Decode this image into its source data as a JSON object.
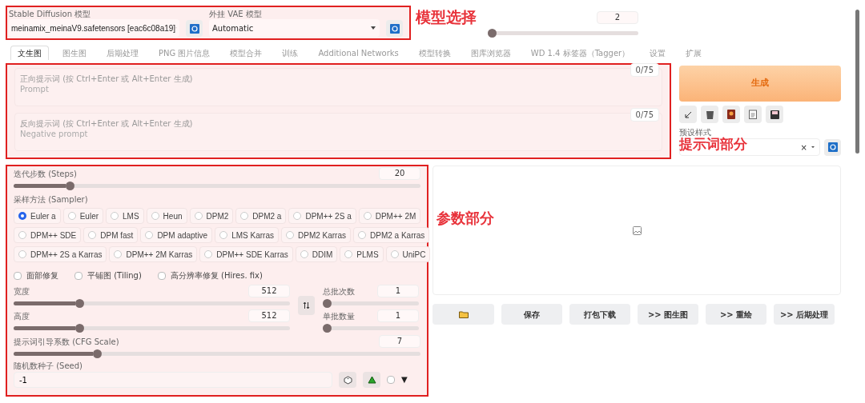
{
  "model_bar": {
    "sd_model": {
      "label": "Stable Diffusion 模型",
      "value": "meinamix_meinaV9.safetensors [eac6c08a19]"
    },
    "vae": {
      "label": "外挂 VAE 模型",
      "value": "Automatic"
    },
    "slider": {
      "value": "2",
      "level": 0
    }
  },
  "annotations": [
    {
      "text": "模型选择"
    },
    {
      "text": "提示词部分"
    },
    {
      "text": "参数部分"
    }
  ],
  "tabs": [
    {
      "label": "文生图",
      "selected": true
    },
    {
      "label": "图生图",
      "selected": false
    },
    {
      "label": "后期处理",
      "selected": false
    },
    {
      "label": "PNG 图片信息",
      "selected": false
    },
    {
      "label": "模型合并",
      "selected": false
    },
    {
      "label": "训练",
      "selected": false
    },
    {
      "label": "Additional Networks",
      "selected": false
    },
    {
      "label": "模型转换",
      "selected": false
    },
    {
      "label": "图库浏览器",
      "selected": false
    },
    {
      "label": "WD 1.4 标签器（Tagger）",
      "selected": false
    },
    {
      "label": "设置",
      "selected": false
    },
    {
      "label": "扩展",
      "selected": false
    }
  ],
  "prompts": [
    {
      "label": "正向提示词 (按 Ctrl+Enter 或 Alt+Enter 生成)",
      "placeholder": "Prompt",
      "counter": "0/75"
    },
    {
      "label": "反向提示词 (按 Ctrl+Enter 或 Alt+Enter 生成)",
      "placeholder": "Negative prompt",
      "counter": "0/75"
    }
  ],
  "generate_button": "生成",
  "styles": {
    "label": "预设样式",
    "clear": "×"
  },
  "steps": {
    "label": "迭代步数 (Steps)",
    "value": "20",
    "level": 0.13
  },
  "sampler": {
    "label": "采样方法 (Sampler)",
    "options": [
      {
        "label": "Euler a",
        "selected": true
      },
      {
        "label": "Euler",
        "selected": false
      },
      {
        "label": "LMS",
        "selected": false
      },
      {
        "label": "Heun",
        "selected": false
      },
      {
        "label": "DPM2",
        "selected": false
      },
      {
        "label": "DPM2 a",
        "selected": false
      },
      {
        "label": "DPM++ 2S a",
        "selected": false
      },
      {
        "label": "DPM++ 2M",
        "selected": false
      },
      {
        "label": "DPM++ SDE",
        "selected": false
      },
      {
        "label": "DPM fast",
        "selected": false
      },
      {
        "label": "DPM adaptive",
        "selected": false
      },
      {
        "label": "LMS Karras",
        "selected": false
      },
      {
        "label": "DPM2 Karras",
        "selected": false
      },
      {
        "label": "DPM2 a Karras",
        "selected": false
      },
      {
        "label": "DPM++ 2S a Karras",
        "selected": false
      },
      {
        "label": "DPM++ 2M Karras",
        "selected": false
      },
      {
        "label": "DPM++ SDE Karras",
        "selected": false
      },
      {
        "label": "DDIM",
        "selected": false
      },
      {
        "label": "PLMS",
        "selected": false
      },
      {
        "label": "UniPC",
        "selected": false
      }
    ]
  },
  "checkboxes": [
    {
      "label": "面部修复",
      "checked": false
    },
    {
      "label": "平铺图 (Tiling)",
      "checked": false
    },
    {
      "label": "高分辨率修复 (Hires. fix)",
      "checked": false
    }
  ],
  "size_sliders": [
    {
      "label": "宽度",
      "value": "512",
      "level": 0.23
    },
    {
      "label": "高度",
      "value": "512",
      "level": 0.23
    }
  ],
  "batch_sliders": [
    {
      "label": "总批次数",
      "value": "1",
      "level": 0
    },
    {
      "label": "单批数量",
      "value": "1",
      "level": 0
    }
  ],
  "cfg": {
    "label": "提示词引导系数 (CFG Scale)",
    "value": "7",
    "level": 0.2
  },
  "seed": {
    "label": "随机数种子 (Seed)",
    "value": "-1",
    "extra_checked": false,
    "expand": "▼"
  },
  "output_buttons": [
    "保存",
    "打包下载",
    ">> 图生图",
    ">> 重绘",
    ">> 后期处理"
  ]
}
